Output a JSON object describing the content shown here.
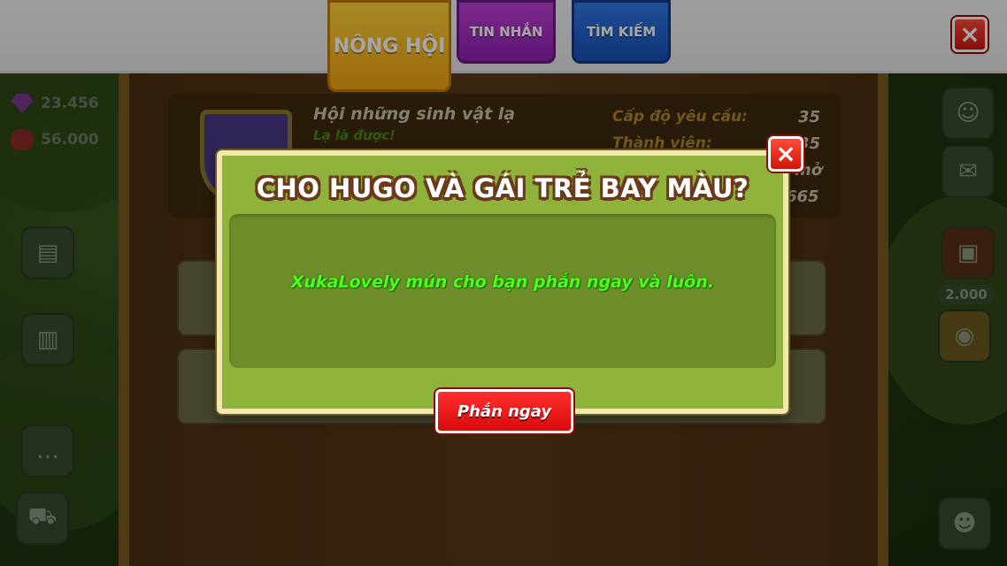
{
  "tabs": {
    "guild": "NÔNG HỘI",
    "messages": "TIN NHẮN",
    "search": "TÌM KIẾM"
  },
  "stats": {
    "gems": "23.456",
    "hearts": "56.000",
    "right_price": "2.000"
  },
  "guild_card": {
    "name": "Hội những sinh vật lạ",
    "motto": "Lạ là được!",
    "required_level_label": "Cấp độ yêu cầu:",
    "required_level_value": "35",
    "members_label": "Thành viên:",
    "members_value": "35",
    "status_fragment": "mở",
    "score_fragment": "665"
  },
  "dialog": {
    "title": "CHO HUGO VÀ GÁI TRẺ BAY MÀU?",
    "message": "XukaLovely mún cho bạn phắn ngay và luôn.",
    "action_label": "Phắn ngay"
  },
  "icons": {
    "close": "close-icon",
    "gem": "gem-icon",
    "heart": "heart-icon"
  },
  "colors": {
    "dialog_bg": "#8fb23a",
    "message_green": "#4cff1a",
    "action_red": "#e01010",
    "tab_guild": "#f7b718",
    "tab_messages": "#a22dc3",
    "tab_search": "#2363cf"
  }
}
